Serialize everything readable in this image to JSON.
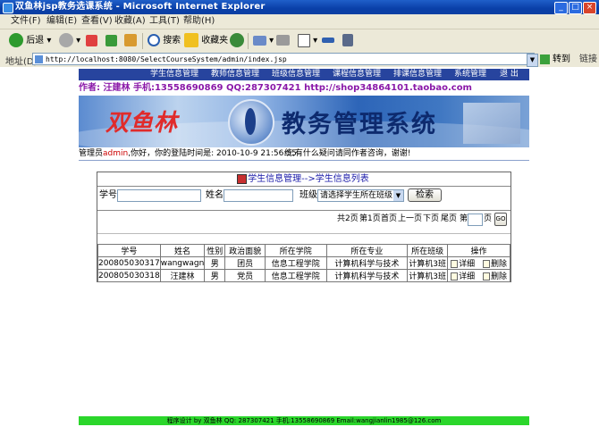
{
  "window": {
    "title": "双鱼林jsp教务选课系统 - Microsoft Internet Explorer",
    "minimize": "_",
    "maximize": "□",
    "close": "×"
  },
  "menu": [
    "文件(F)",
    "编辑(E)",
    "查看(V)",
    "收藏(A)",
    "工具(T)",
    "帮助(H)"
  ],
  "toolbar": {
    "back": "后退",
    "search": "搜索",
    "favorites": "收藏夹"
  },
  "address": {
    "label": "地址(D)",
    "url": "http://localhost:8080/SelectCourseSystem/admin/index.jsp",
    "go": "转到",
    "links": "链接"
  },
  "nav": [
    "学生信息管理",
    "教师信息管理",
    "班级信息管理",
    "课程信息管理",
    "排课信息管理",
    "系统管理",
    "退 出"
  ],
  "author_line": "作者: 汪建林  手机:13558690869  QQ:287307421  http://shop34864101.taobao.com",
  "banner": {
    "logo": "双鱼林",
    "system_name": "教务管理系统"
  },
  "status": {
    "prefix": "管理员",
    "user": "admin",
    "text": ",你好，你的登陆时间是: 2010-10-9 21:56:55",
    "right": "统,有什么疑问请同作者咨询，谢谢!"
  },
  "panel": {
    "title": "学生信息管理-->学生信息列表",
    "student_no_label": "学号:",
    "name_label": "姓名:",
    "class_label": "班级:",
    "class_select": "请选择学生所在班级",
    "search_button": "检索"
  },
  "pager": {
    "total_pages": "共2页",
    "current": "第1页",
    "first": "首页",
    "prev": "上一页",
    "next": "下页",
    "last": "尾页",
    "jump_prefix": "第",
    "jump_suffix": "页",
    "go": "GO"
  },
  "table": {
    "headers": [
      "学号",
      "姓名",
      "性别",
      "政治面貌",
      "所在学院",
      "所在专业",
      "所在班级",
      "操作"
    ],
    "rows": [
      [
        "200805030317",
        "wangwagn",
        "男",
        "团员",
        "信息工程学院",
        "计算机科学与技术",
        "计算机3班"
      ],
      [
        "200805030318",
        "汪建林",
        "男",
        "党员",
        "信息工程学院",
        "计算机科学与技术",
        "计算机3班"
      ]
    ],
    "detail": "详细",
    "delete": "删除"
  },
  "footer": "程序设计 by 双鱼林  QQ: 287307421 手机:13558690869 Email:wangjianlin1985@126.com"
}
